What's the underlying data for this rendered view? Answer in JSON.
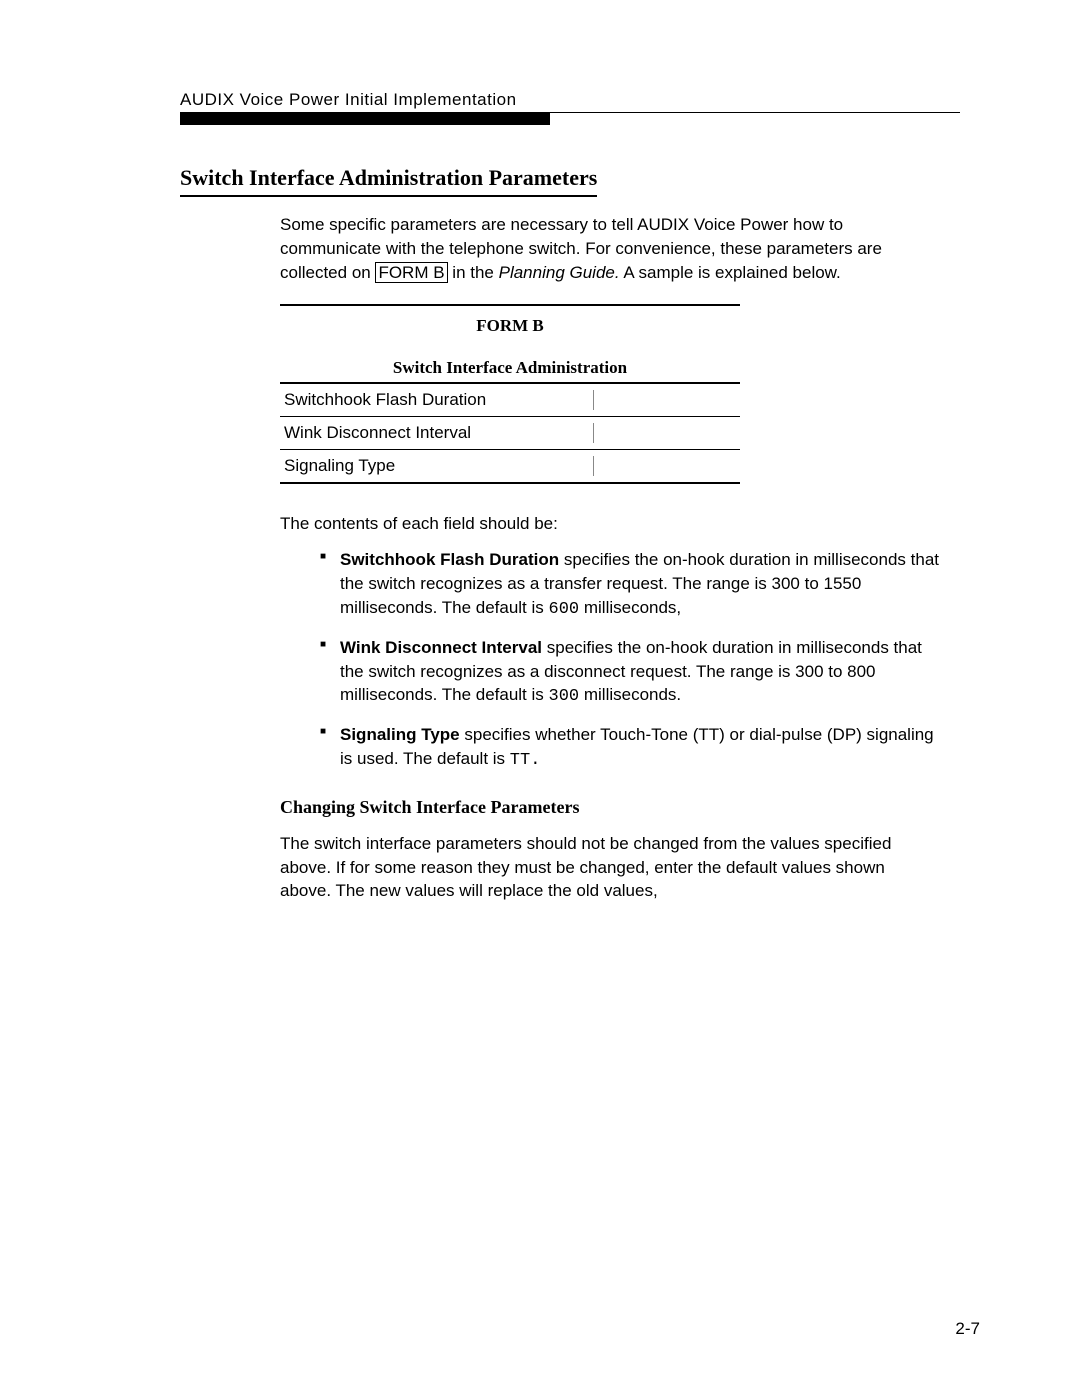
{
  "header": {
    "title": "AUDIX Voice Power Initial Implementation"
  },
  "section": {
    "title": "Switch Interface Administration Parameters",
    "intro_part1": "Some specific parameters are necessary to tell AUDIX Voice Power how to communicate with the telephone switch. For convenience, these parameters are collected on ",
    "form_link": "FORM B",
    "intro_part2": " in the ",
    "intro_italic": "Planning Guide.",
    "intro_part3": " A sample is explained below."
  },
  "form": {
    "title": "FORM B",
    "table_title": "Switch Interface Administration",
    "rows": [
      "Switchhook Flash Duration",
      "Wink Disconnect Interval",
      "Signaling Type"
    ]
  },
  "contents": {
    "intro": "The contents of each field should be:",
    "bullets": [
      {
        "bold": "Switchhook Flash Duration",
        "text_a": " specifies the on-hook duration in milliseconds that the switch recognizes as a transfer request. The range is 300 to 1550 milliseconds. The default is ",
        "mono": "600",
        "text_b": " milliseconds,"
      },
      {
        "bold": "Wink Disconnect Interval",
        "text_a": " specifies the on-hook duration in milliseconds that the switch recognizes as a disconnect request. The range is 300 to 800 milliseconds. The default is ",
        "mono": "300",
        "text_b": " milliseconds."
      },
      {
        "bold": "Signaling Type",
        "text_a": " specifies whether Touch-Tone (TT) or dial-pulse (DP) signaling is used. The default is ",
        "mono": "TT.",
        "text_b": ""
      }
    ]
  },
  "subsection": {
    "title": "Changing Switch Interface Parameters",
    "body": "The switch interface parameters should not be changed from the values specified above. If for some reason they must be changed, enter the default values shown above. The new values will replace the old values,"
  },
  "page_number": "2-7"
}
